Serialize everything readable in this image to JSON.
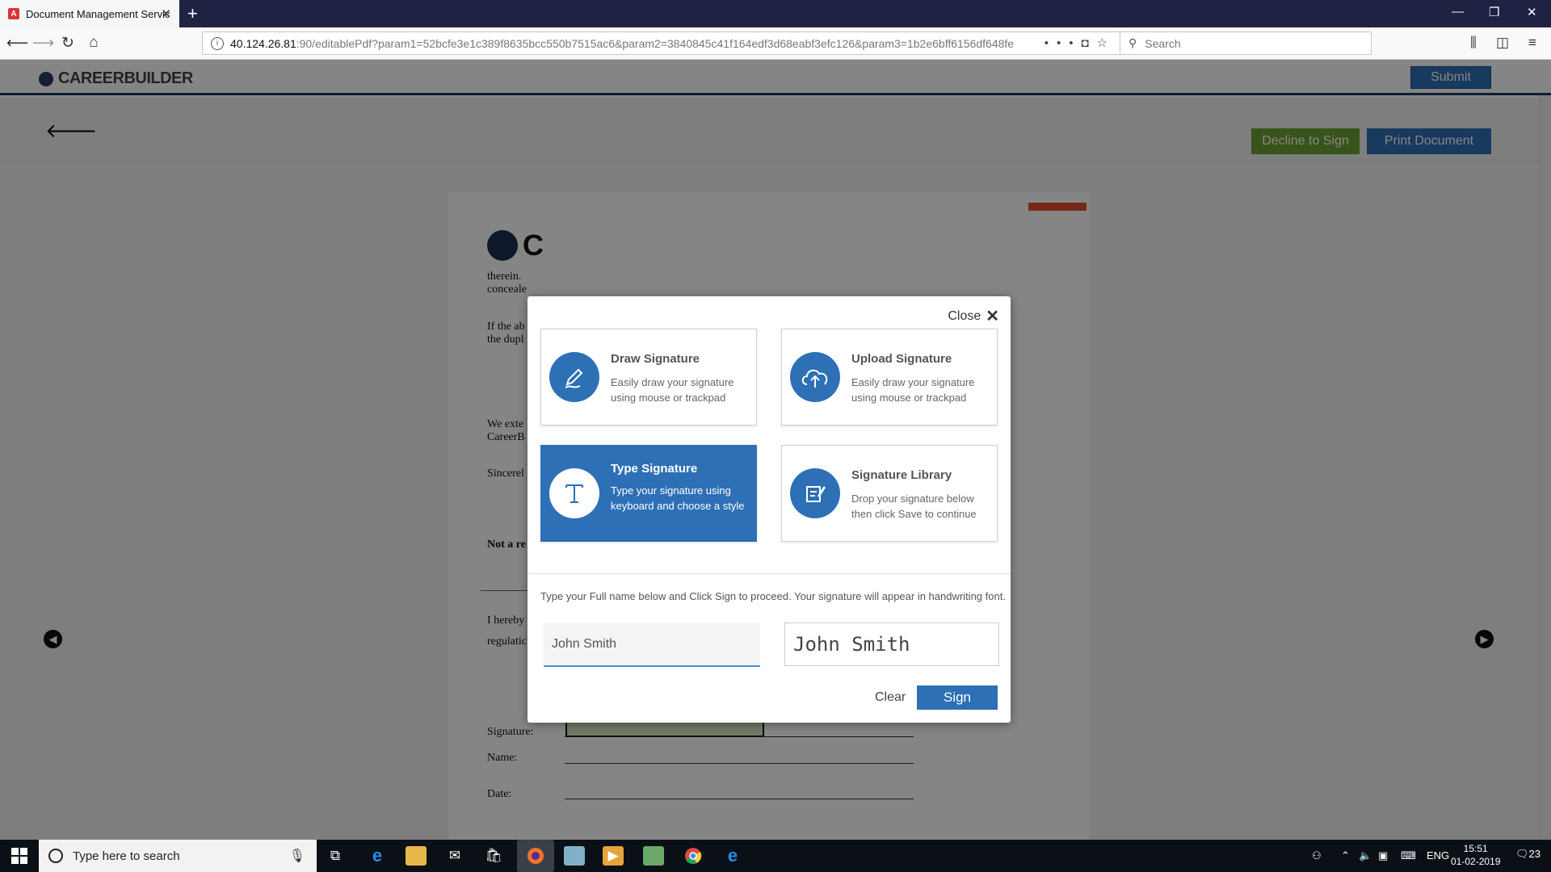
{
  "browser": {
    "tab_title": "Document Management Servic",
    "new_tab": "+",
    "url_host": "40.124.26.81",
    "url_path": ":90/editablePdf?param1=52bcfe3e1c389f8635bcc550b7515ac6&param2=3840845c41f164edf3d68eabf3efc126&param3=1b2e6bff6156df648fe",
    "search_placeholder": "Search"
  },
  "app": {
    "logo_text": "CAREERBUILDER",
    "submit_label": "Submit",
    "decline_label": "Decline to Sign",
    "print_label": "Print Document"
  },
  "document": {
    "logo_text": "C",
    "para1_line1": "therein.",
    "para1_line2": "conceale",
    "para2_line1": "If the ab",
    "para2_line2": "the dupl",
    "para3_line1": "We exte",
    "para3_line2": "CareerB",
    "sincerely": "Sincerel",
    "not_a": "Not a re",
    "hereby_line1": "I hereby",
    "hereby_line2": "regulatic",
    "signature_label": "Signature:",
    "name_label": "Name:",
    "date_label": "Date:"
  },
  "modal": {
    "close_label": "Close",
    "options": [
      {
        "title": "Draw Signature",
        "desc": "Easily draw your signature using mouse or trackpad",
        "icon": "pen-icon"
      },
      {
        "title": "Upload Signature",
        "desc": "Easily draw your signature using mouse or trackpad",
        "icon": "cloud-upload-icon"
      },
      {
        "title": "Type Signature",
        "desc": "Type your signature using keyboard and choose a style",
        "icon": "text-t-icon"
      },
      {
        "title": "Signature Library",
        "desc": "Drop your signature below then click Save to continue",
        "icon": "library-edit-icon"
      }
    ],
    "instructions": "Type your Full name below and Click Sign to proceed. Your signature will appear in handwriting font.",
    "name_value": "John Smith",
    "preview_text": "John Smith",
    "clear_label": "Clear",
    "sign_label": "Sign"
  },
  "taskbar": {
    "search_placeholder": "Type here to search",
    "lang": "ENG",
    "time": "15:51",
    "date": "01-02-2019",
    "notification_count": "23"
  },
  "colors": {
    "primary": "#2d70b5",
    "decline": "#6ca232",
    "titlebar": "#1f2243"
  }
}
